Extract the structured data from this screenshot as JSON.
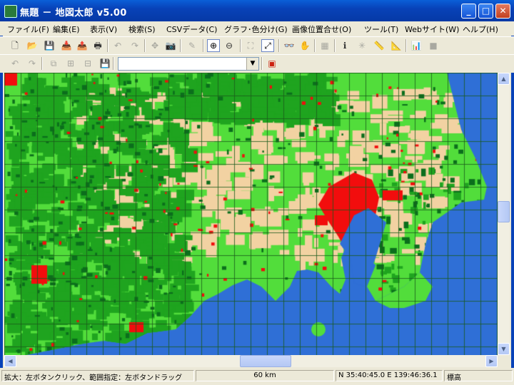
{
  "window": {
    "title": "無題 － 地図太郎 v5.00",
    "minimize_glyph": "_",
    "maximize_glyph": "□",
    "close_glyph": "✕"
  },
  "menu": [
    "ファイル(F)",
    "編集(E)",
    "表示(V)",
    "検索(S)",
    "CSVデータ(C)",
    "グラフ･色分け(G)",
    "画像位置合せ(O)",
    "ツール(T)",
    "Webサイト(W)",
    "ヘルプ(H)"
  ],
  "toolbar1": {
    "buttons": [
      {
        "name": "new-file-icon",
        "glyph": "🗋"
      },
      {
        "name": "open-folder-icon",
        "glyph": "📂"
      },
      {
        "name": "save-icon",
        "glyph": "💾"
      },
      {
        "name": "import-icon",
        "glyph": "📥"
      },
      {
        "name": "export-icon",
        "glyph": "📤"
      },
      {
        "name": "print-icon",
        "glyph": "🖶"
      },
      {
        "name": "undo-icon",
        "glyph": "↶"
      },
      {
        "name": "redo-icon",
        "glyph": "↷"
      },
      {
        "name": "move-icon",
        "glyph": "✥"
      },
      {
        "name": "camera-icon",
        "glyph": "📷"
      },
      {
        "name": "edit-icon",
        "glyph": "✎"
      },
      {
        "name": "zoom-in-icon",
        "glyph": "⊕"
      },
      {
        "name": "zoom-out-icon",
        "glyph": "⊖"
      },
      {
        "name": "fit-icon",
        "glyph": "⛶"
      },
      {
        "name": "full-extent-icon",
        "glyph": "⤢"
      },
      {
        "name": "binoculars-icon",
        "glyph": "👓"
      },
      {
        "name": "hand-icon",
        "glyph": "✋"
      },
      {
        "name": "table-icon",
        "glyph": "▦"
      },
      {
        "name": "info-icon",
        "glyph": "ℹ"
      },
      {
        "name": "sun-icon",
        "glyph": "✳"
      },
      {
        "name": "ruler-icon",
        "glyph": "📏"
      },
      {
        "name": "area-measure-icon",
        "glyph": "📐"
      },
      {
        "name": "bar-chart-icon",
        "glyph": "📊"
      },
      {
        "name": "color-fill-icon",
        "glyph": "■"
      }
    ]
  },
  "toolbar2": {
    "buttons": [
      {
        "name": "back-icon",
        "glyph": "↶"
      },
      {
        "name": "forward-icon",
        "glyph": "↷"
      },
      {
        "name": "layer-icon-1",
        "glyph": "⧉"
      },
      {
        "name": "layer-icon-2",
        "glyph": "⊞"
      },
      {
        "name": "layer-icon-3",
        "glyph": "⊟"
      },
      {
        "name": "layer-save-icon",
        "glyph": "💾"
      }
    ],
    "combo_value": "",
    "color_tool_glyph": "▣"
  },
  "status": {
    "hint": "拡大：左ボタンクリック、範囲指定：左ボタンドラッグ",
    "scale": "60 km",
    "coords": "N 35:40:45.0  E 139:46:36.1",
    "elevation_label": "標高"
  },
  "colors": {
    "urban": "#f20d0d",
    "forest_dark": "#0b6e1c",
    "forest": "#1fa41f",
    "field": "#52dd3b",
    "farm": "#f2d2a2",
    "sea": "#2f6fd6",
    "grid": "#1b5a1b"
  }
}
